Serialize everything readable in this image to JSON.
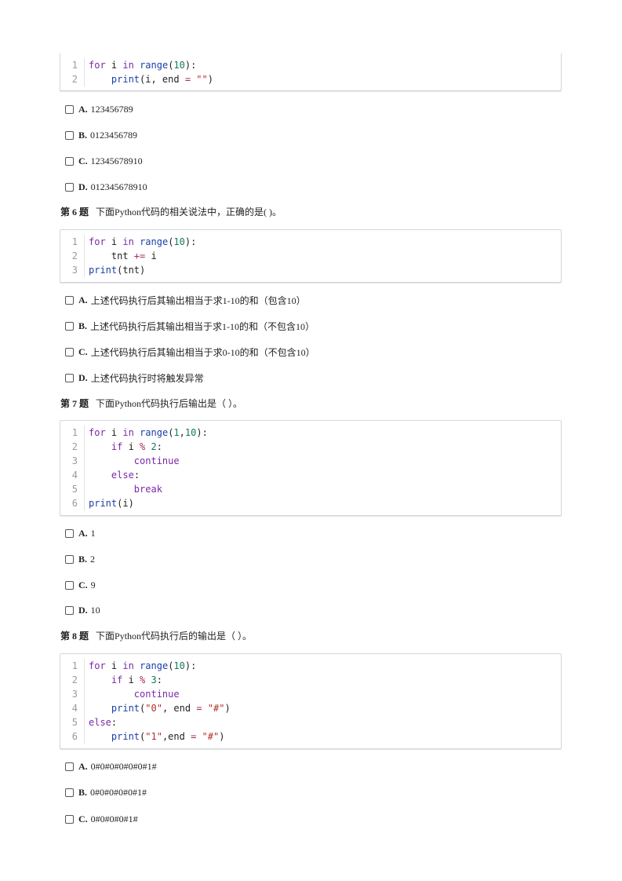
{
  "q5": {
    "code": [
      {
        "n": "1",
        "tokens": [
          {
            "t": "for",
            "c": "kw"
          },
          {
            "t": " i ",
            "c": ""
          },
          {
            "t": "in",
            "c": "kw"
          },
          {
            "t": " ",
            "c": ""
          },
          {
            "t": "range",
            "c": "fn"
          },
          {
            "t": "(",
            "c": ""
          },
          {
            "t": "10",
            "c": "num"
          },
          {
            "t": "):",
            "c": ""
          }
        ]
      },
      {
        "n": "2",
        "tokens": [
          {
            "t": "    ",
            "c": ""
          },
          {
            "t": "print",
            "c": "fn"
          },
          {
            "t": "(i, end ",
            "c": ""
          },
          {
            "t": "=",
            "c": "op"
          },
          {
            "t": " ",
            "c": ""
          },
          {
            "t": "\"\"",
            "c": "str"
          },
          {
            "t": ")",
            "c": ""
          }
        ]
      }
    ],
    "options": [
      {
        "letter": "A.",
        "text": "123456789"
      },
      {
        "letter": "B.",
        "text": "0123456789"
      },
      {
        "letter": "C.",
        "text": "12345678910"
      },
      {
        "letter": "D.",
        "text": "012345678910"
      }
    ]
  },
  "q6": {
    "number": "第 6 题",
    "text": "下面Python代码的相关说法中，正确的是( )。",
    "code": [
      {
        "n": "1",
        "tokens": [
          {
            "t": "for",
            "c": "kw"
          },
          {
            "t": " i ",
            "c": ""
          },
          {
            "t": "in",
            "c": "kw"
          },
          {
            "t": " ",
            "c": ""
          },
          {
            "t": "range",
            "c": "fn"
          },
          {
            "t": "(",
            "c": ""
          },
          {
            "t": "10",
            "c": "num"
          },
          {
            "t": "):",
            "c": ""
          }
        ]
      },
      {
        "n": "2",
        "tokens": [
          {
            "t": "    tnt ",
            "c": ""
          },
          {
            "t": "+=",
            "c": "op"
          },
          {
            "t": " i",
            "c": ""
          }
        ]
      },
      {
        "n": "3",
        "tokens": [
          {
            "t": "print",
            "c": "fn"
          },
          {
            "t": "(tnt)",
            "c": ""
          }
        ]
      }
    ],
    "options": [
      {
        "letter": "A.",
        "text": "上述代码执行后其输出相当于求1-10的和（包含10）"
      },
      {
        "letter": "B.",
        "text": "上述代码执行后其输出相当于求1-10的和（不包含10）"
      },
      {
        "letter": "C.",
        "text": "上述代码执行后其输出相当于求0-10的和（不包含10）"
      },
      {
        "letter": "D.",
        "text": "上述代码执行时将触发异常"
      }
    ]
  },
  "q7": {
    "number": "第 7 题",
    "text": "下面Python代码执行后输出是（    ）。",
    "code": [
      {
        "n": "1",
        "tokens": [
          {
            "t": "for",
            "c": "kw"
          },
          {
            "t": " i ",
            "c": ""
          },
          {
            "t": "in",
            "c": "kw"
          },
          {
            "t": " ",
            "c": ""
          },
          {
            "t": "range",
            "c": "fn"
          },
          {
            "t": "(",
            "c": ""
          },
          {
            "t": "1",
            "c": "num"
          },
          {
            "t": ",",
            "c": ""
          },
          {
            "t": "10",
            "c": "num"
          },
          {
            "t": "):",
            "c": ""
          }
        ]
      },
      {
        "n": "2",
        "tokens": [
          {
            "t": "    ",
            "c": ""
          },
          {
            "t": "if",
            "c": "kw"
          },
          {
            "t": " i ",
            "c": ""
          },
          {
            "t": "%",
            "c": "op"
          },
          {
            "t": " ",
            "c": ""
          },
          {
            "t": "2",
            "c": "num"
          },
          {
            "t": ":",
            "c": ""
          }
        ]
      },
      {
        "n": "3",
        "tokens": [
          {
            "t": "        ",
            "c": ""
          },
          {
            "t": "continue",
            "c": "kw"
          }
        ]
      },
      {
        "n": "4",
        "tokens": [
          {
            "t": "    ",
            "c": ""
          },
          {
            "t": "else",
            "c": "kw"
          },
          {
            "t": ":",
            "c": ""
          }
        ]
      },
      {
        "n": "5",
        "tokens": [
          {
            "t": "        ",
            "c": ""
          },
          {
            "t": "break",
            "c": "kw"
          }
        ]
      },
      {
        "n": "6",
        "tokens": [
          {
            "t": "print",
            "c": "fn"
          },
          {
            "t": "(i)",
            "c": ""
          }
        ]
      }
    ],
    "options": [
      {
        "letter": "A.",
        "text": "1"
      },
      {
        "letter": "B.",
        "text": "2"
      },
      {
        "letter": "C.",
        "text": "9"
      },
      {
        "letter": "D.",
        "text": "10"
      }
    ]
  },
  "q8": {
    "number": "第 8 题",
    "text": "下面Python代码执行后的输出是（  ）。",
    "code": [
      {
        "n": "1",
        "tokens": [
          {
            "t": "for",
            "c": "kw"
          },
          {
            "t": " i ",
            "c": ""
          },
          {
            "t": "in",
            "c": "kw"
          },
          {
            "t": " ",
            "c": ""
          },
          {
            "t": "range",
            "c": "fn"
          },
          {
            "t": "(",
            "c": ""
          },
          {
            "t": "10",
            "c": "num"
          },
          {
            "t": "):",
            "c": ""
          }
        ]
      },
      {
        "n": "2",
        "tokens": [
          {
            "t": "    ",
            "c": ""
          },
          {
            "t": "if",
            "c": "kw"
          },
          {
            "t": " i ",
            "c": ""
          },
          {
            "t": "%",
            "c": "op"
          },
          {
            "t": " ",
            "c": ""
          },
          {
            "t": "3",
            "c": "num"
          },
          {
            "t": ":",
            "c": ""
          }
        ]
      },
      {
        "n": "3",
        "tokens": [
          {
            "t": "        ",
            "c": ""
          },
          {
            "t": "continue",
            "c": "kw"
          }
        ]
      },
      {
        "n": "4",
        "tokens": [
          {
            "t": "    ",
            "c": ""
          },
          {
            "t": "print",
            "c": "fn"
          },
          {
            "t": "(",
            "c": ""
          },
          {
            "t": "\"0\"",
            "c": "str"
          },
          {
            "t": ", end ",
            "c": ""
          },
          {
            "t": "=",
            "c": "op"
          },
          {
            "t": " ",
            "c": ""
          },
          {
            "t": "\"#\"",
            "c": "str"
          },
          {
            "t": ")",
            "c": ""
          }
        ]
      },
      {
        "n": "5",
        "tokens": [
          {
            "t": "else",
            "c": "kw"
          },
          {
            "t": ":",
            "c": ""
          }
        ]
      },
      {
        "n": "6",
        "tokens": [
          {
            "t": "    ",
            "c": ""
          },
          {
            "t": "print",
            "c": "fn"
          },
          {
            "t": "(",
            "c": ""
          },
          {
            "t": "\"1\"",
            "c": "str"
          },
          {
            "t": ",end ",
            "c": ""
          },
          {
            "t": "=",
            "c": "op"
          },
          {
            "t": " ",
            "c": ""
          },
          {
            "t": "\"#\"",
            "c": "str"
          },
          {
            "t": ")",
            "c": ""
          }
        ]
      }
    ],
    "options": [
      {
        "letter": "A.",
        "text": "0#0#0#0#0#0#1#"
      },
      {
        "letter": "B.",
        "text": "0#0#0#0#0#1#"
      },
      {
        "letter": "C.",
        "text": "0#0#0#0#1#"
      }
    ]
  }
}
